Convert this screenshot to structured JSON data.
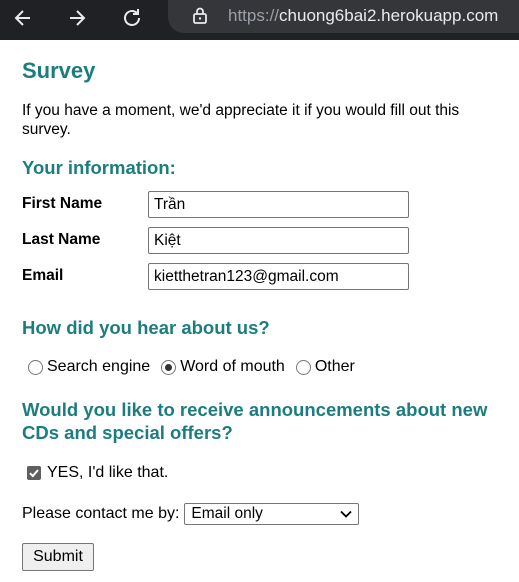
{
  "browser": {
    "url_scheme": "https://",
    "url_host": "chuong6bai2.herokuapp.com"
  },
  "page": {
    "title": "Survey",
    "intro": "If you have a moment, we'd appreciate it if you would fill out this survey."
  },
  "info_section": {
    "heading": "Your information:",
    "fields": [
      {
        "label": "First Name",
        "value": "Trần"
      },
      {
        "label": "Last Name",
        "value": "Kiệt"
      },
      {
        "label": "Email",
        "value": "kietthetran123@gmail.com"
      }
    ]
  },
  "hear_section": {
    "heading": "How did you hear about us?",
    "options": [
      {
        "label": "Search engine",
        "checked": false
      },
      {
        "label": "Word of mouth",
        "checked": true
      },
      {
        "label": "Other",
        "checked": false
      }
    ]
  },
  "announce_section": {
    "heading": "Would you like to receive announcements about new CDs and special offers?",
    "checkbox_label": "YES, I'd like that.",
    "checkbox_checked": true,
    "contact_label": "Please contact me by:",
    "contact_value": "Email only"
  },
  "submit_label": "Submit",
  "colors": {
    "heading": "#1c7d80",
    "browser_bar": "#202124",
    "url_box": "#35363a"
  }
}
